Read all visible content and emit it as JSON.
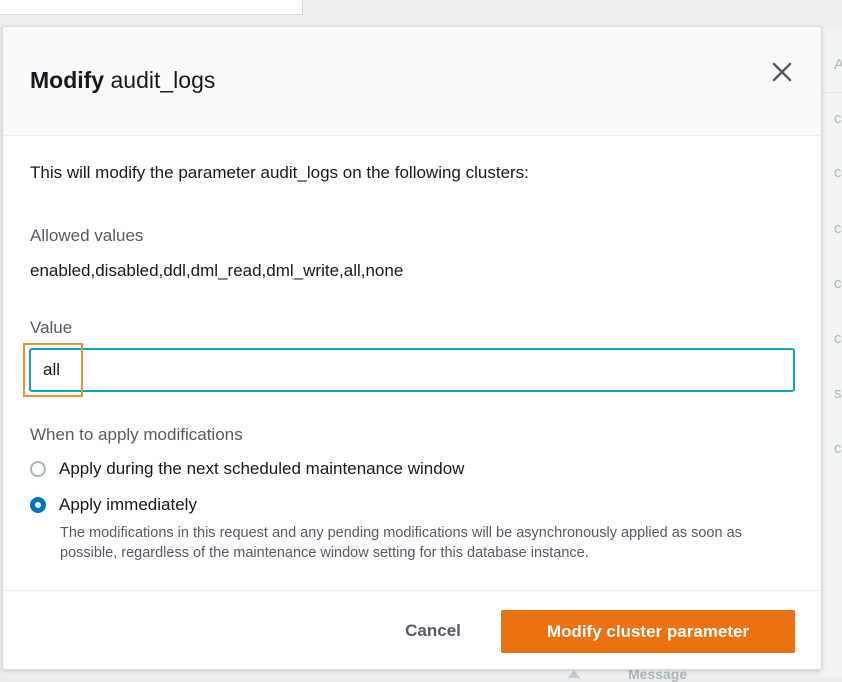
{
  "background": {
    "right_column_letters": [
      "A",
      "c",
      "c",
      "c",
      "c",
      "c",
      "s",
      "c"
    ],
    "bottom_ghost_text": "Message"
  },
  "modal": {
    "title_bold": "Modify",
    "title_param": "audit_logs",
    "close_icon": "close-icon",
    "intro_text": "This will modify the parameter audit_logs on the following clusters:",
    "allowed_values_label": "Allowed values",
    "allowed_values": "enabled,disabled,ddl,dml_read,dml_write,all,none",
    "value_label": "Value",
    "value_input": "all",
    "apply_label": "When to apply modifications",
    "options": [
      {
        "label": "Apply during the next scheduled maintenance window",
        "checked": false
      },
      {
        "label": "Apply immediately",
        "checked": true
      }
    ],
    "immediate_description": "The modifications in this request and any pending modifications will be asynchronously applied as soon as possible, regardless of the maintenance window setting for this database instance.",
    "cancel_label": "Cancel",
    "submit_label": "Modify cluster parameter"
  },
  "colors": {
    "primary": "#ec7211",
    "focus_border": "#0aa4c2",
    "highlight": "#f0932b",
    "radio_checked": "#0073bb"
  }
}
